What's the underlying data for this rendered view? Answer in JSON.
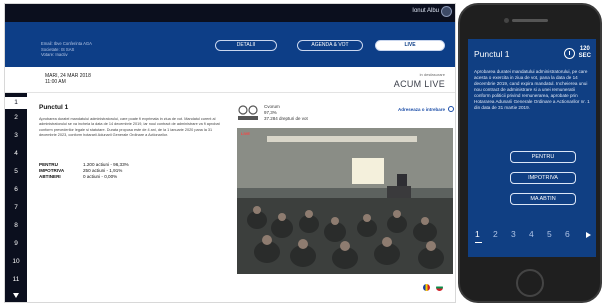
{
  "topbar": {
    "user_name": "Ionut Albu"
  },
  "header": {
    "info_line1": "Email: Ibve Conferinta AGA",
    "info_line2": "Societate: IS SAS",
    "info_line3": "Votare: Inactiv",
    "tabs": [
      {
        "label": "DETALII",
        "active": false
      },
      {
        "label": "AGENDA & VOT",
        "active": false
      },
      {
        "label": "LIVE",
        "active": true
      }
    ]
  },
  "meta": {
    "date": "MARI, 24 MAR 2018",
    "time": "11:00 AM",
    "status_label": "in desfasurare",
    "status": "ACUM LIVE"
  },
  "sidenav": {
    "items": [
      "1",
      "2",
      "3",
      "4",
      "5",
      "6",
      "7",
      "8",
      "9",
      "10",
      "11"
    ],
    "active_index": 0
  },
  "point": {
    "title": "Punctul 1",
    "text": "Aprobarea duratei mandatului administratorului, care poate fi exprimata in ziua de vot. Mandatul curent al administratorului se va incheia la data de 14 decembrie 2019, iar noul contract de administrare va fi aprobat conform prevederilor legale si statutare. Durata propusa este de 4 ani, de la 1 ianuarie 2020 pana la 31 decembrie 2023, conform hotararii Adunarii Generale Ordinare a Actionarilor."
  },
  "votes": [
    {
      "label": "PENTRU",
      "value": "1.200 actiuni - 96,33%"
    },
    {
      "label": "IMPOTRIVA",
      "value": "250 actiuni - 1,91%"
    },
    {
      "label": "ABTINERI",
      "value": "0 actiuni - 0,00%"
    }
  ],
  "stream": {
    "logo_name": "meeting-logo",
    "stat_line1": "Cvorum",
    "stat_line2": "97,3%",
    "stat_line3": "37.284 drepturi de vot",
    "link_label": "Adreseaza o intrebare",
    "rec_label": "LIVE"
  },
  "flags": [
    "ro-flag-icon",
    "bg-flag-icon",
    "hu-flag-icon"
  ],
  "phone": {
    "title": "Punctul 1",
    "timer_value": "120",
    "timer_unit": "SEC",
    "text": "Aprobarea duratei mandatului administratorului, pe care acesta o exercita in ziua de vot, pana la data de 14 decembrie 2019, cand expira mandatul. Incheierea unui nou contract de administrare si a unei remuneratii conform politicii privind remunerarea, aprobate prin Hotararea Adunarii Generale Ordinare a Actionarilor nr. 1 din data de 31 martie 2019.",
    "buttons": [
      "PENTRU",
      "IMPOTRIVA",
      "MA ABTIN"
    ],
    "pages": [
      "1",
      "2",
      "3",
      "4",
      "5",
      "6"
    ],
    "active_page": 0
  },
  "colors": {
    "brand_blue": "#0d3e87",
    "dark_nav": "#0b0f1e",
    "link_blue": "#1c4ea8"
  }
}
